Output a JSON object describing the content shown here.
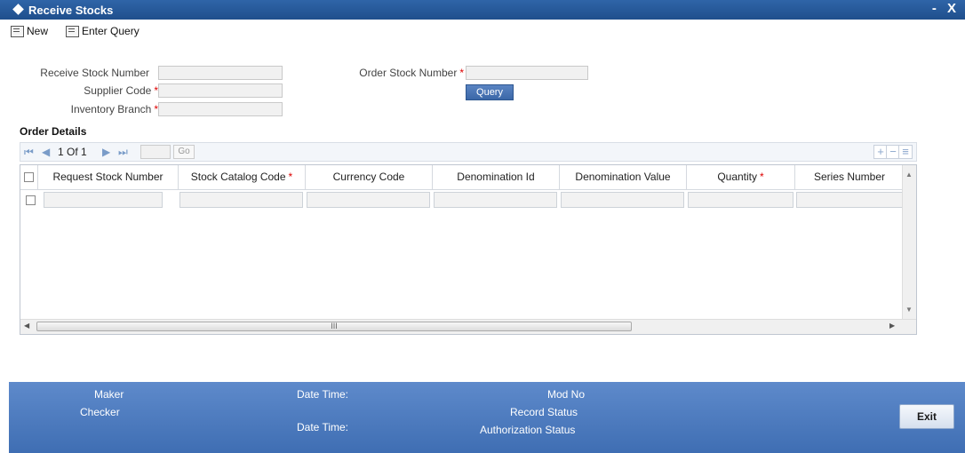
{
  "window": {
    "title": "Receive Stocks",
    "controls": "- X"
  },
  "toolbar": {
    "new_label": "New",
    "enter_query_label": "Enter Query"
  },
  "form": {
    "receive_stock_number": {
      "label": "Receive Stock Number",
      "value": ""
    },
    "supplier_code": {
      "label": "Supplier Code",
      "value": ""
    },
    "inventory_branch": {
      "label": "Inventory Branch",
      "value": ""
    },
    "order_stock_number": {
      "label": "Order Stock Number",
      "value": ""
    },
    "query_button": "Query",
    "required_mark": "*"
  },
  "order_details": {
    "title": "Order Details",
    "pager": {
      "first": "⏮",
      "prev": "◀",
      "page_text": "1 Of 1",
      "next": "▶",
      "last": "⏭",
      "go": "Go",
      "add": "+",
      "remove": "−",
      "view": "≡"
    },
    "columns": [
      {
        "label": "Request Stock Number",
        "required": false
      },
      {
        "label": "Stock Catalog Code",
        "required": true
      },
      {
        "label": "Currency Code",
        "required": false
      },
      {
        "label": "Denomination Id",
        "required": false
      },
      {
        "label": "Denomination Value",
        "required": false
      },
      {
        "label": "Quantity",
        "required": true
      },
      {
        "label": "Series Number",
        "required": false
      }
    ],
    "scroll_thumb": "III"
  },
  "footer": {
    "maker": "Maker",
    "checker": "Checker",
    "date_time_1": "Date Time:",
    "date_time_2": "Date Time:",
    "mod_no": "Mod No",
    "record_status": "Record Status",
    "authorization_status": "Authorization Status",
    "exit": "Exit"
  },
  "colors": {
    "titlebar": "#1f4f8c",
    "footer": "#4f7dc0",
    "required": "#dd0000",
    "query_button": "#3b67a8"
  }
}
